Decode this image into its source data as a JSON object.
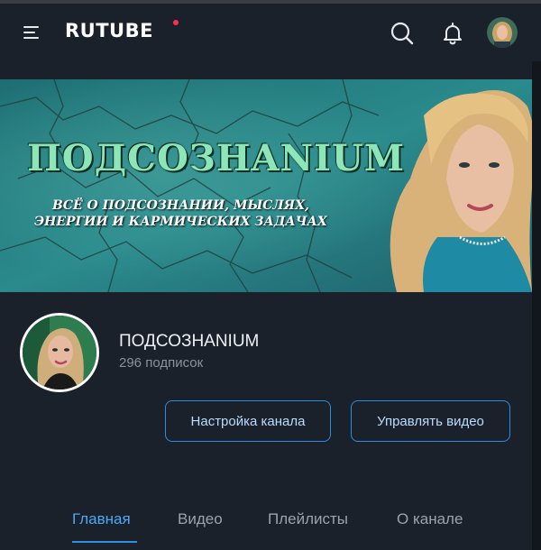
{
  "header": {
    "logo_text": "RUTUBE",
    "menu_icon": "menu-icon",
    "search_icon": "search-icon",
    "notifications_icon": "bell-icon",
    "avatar": "user-avatar"
  },
  "banner": {
    "title": "ПОДСОЗНANIUM",
    "subtitle_line1": "ВСЁ О ПОДСОЗНАНИИ, МЫСЛЯХ,",
    "subtitle_line2": "ЭНЕРГИИ И КАРМИЧЕСКИХ ЗАДАЧАХ"
  },
  "channel": {
    "name": "ПОДСОЗНANIUM",
    "subscribers": "296 подписок"
  },
  "actions": {
    "settings_label": "Настройка канала",
    "manage_videos_label": "Управлять видео"
  },
  "tabs": [
    {
      "label": "Главная",
      "active": true
    },
    {
      "label": "Видео",
      "active": false
    },
    {
      "label": "Плейлисты",
      "active": false
    },
    {
      "label": "О канале",
      "active": false
    }
  ],
  "colors": {
    "background": "#1b212b",
    "accent": "#2f8fe6",
    "banner_title": "#8ee6b8"
  }
}
